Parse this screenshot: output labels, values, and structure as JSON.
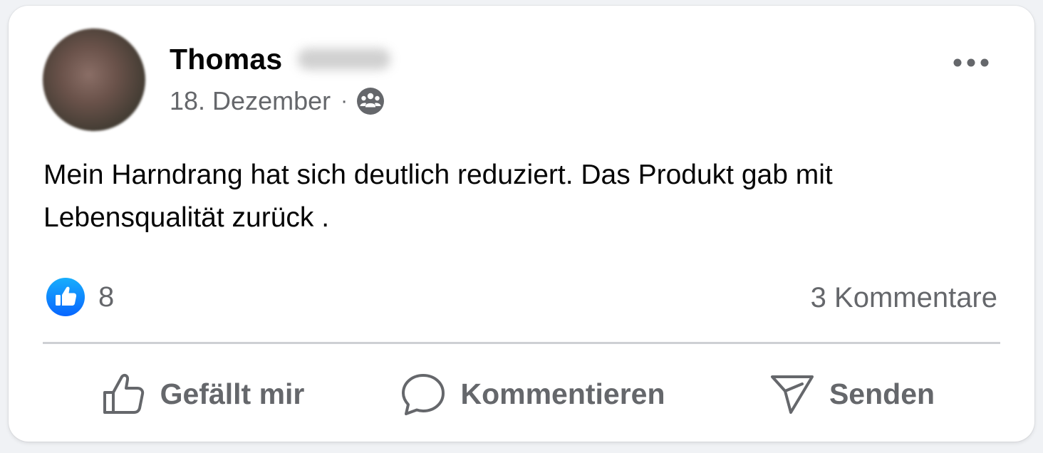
{
  "post": {
    "author": {
      "first_name": "Thomas",
      "avatar_icon": "avatar-blurred"
    },
    "date": "18. Dezember",
    "separator": "·",
    "audience_icon": "friends-audience-icon",
    "more_icon": "more-horizontal-icon",
    "text": "Mein Harndrang hat sich deutlich reduziert. Das Produkt gab mit Lebensqualität zurück ."
  },
  "stats": {
    "like_icon": "like-reaction-icon",
    "like_count": "8",
    "comments": "3 Kommentare"
  },
  "actions": {
    "like_label": "Gefällt mir",
    "comment_label": "Kommentieren",
    "send_label": "Senden"
  },
  "colors": {
    "text_primary": "#050505",
    "text_secondary": "#65676b",
    "like_blue": "#1877f2",
    "divider": "#ced0d4",
    "card_bg": "#ffffff"
  }
}
